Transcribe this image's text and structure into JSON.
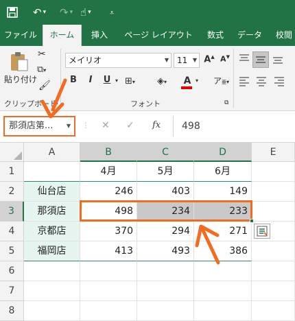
{
  "quick_access": {
    "save_icon": "save-icon",
    "undo_icon": "undo-icon",
    "redo_icon": "redo-icon",
    "touch_icon": "touch-mode-icon",
    "customize_icon": "customize-qat-icon"
  },
  "tabs": [
    "ファイル",
    "ホーム",
    "挿入",
    "ページ レイアウト",
    "数式",
    "データ",
    "校閲"
  ],
  "active_tab": "ホーム",
  "ribbon": {
    "paste_label": "貼り付け",
    "clipboard_group": "クリップボード",
    "font_group": "フォント",
    "font_name": "メイリオ",
    "font_size": "11",
    "bold": "B",
    "italic": "I",
    "underline": "U",
    "grow_font": "A",
    "shrink_font": "A",
    "font_color_letter": "A",
    "font_color": "#e00000"
  },
  "formula_bar": {
    "name_box": "那須店第...",
    "fx_label": "fx",
    "value": "498"
  },
  "sheet": {
    "columns": [
      "A",
      "B",
      "C",
      "D",
      "E"
    ],
    "rows": [
      "1",
      "2",
      "3",
      "4",
      "5",
      "6",
      "7",
      "8"
    ],
    "headers": [
      "",
      "4月",
      "5月",
      "6月"
    ],
    "data": [
      [
        "仙台店",
        "246",
        "403",
        "149"
      ],
      [
        "那須店",
        "498",
        "234",
        "233"
      ],
      [
        "京都店",
        "370",
        "294",
        "271"
      ],
      [
        "福岡店",
        "413",
        "493",
        "386"
      ]
    ]
  },
  "colors": {
    "excel_green": "#217346",
    "highlight_orange": "#f26b21",
    "selected_cell_gray": "#c9c9c9",
    "store_fill": "#e6f5ef"
  }
}
